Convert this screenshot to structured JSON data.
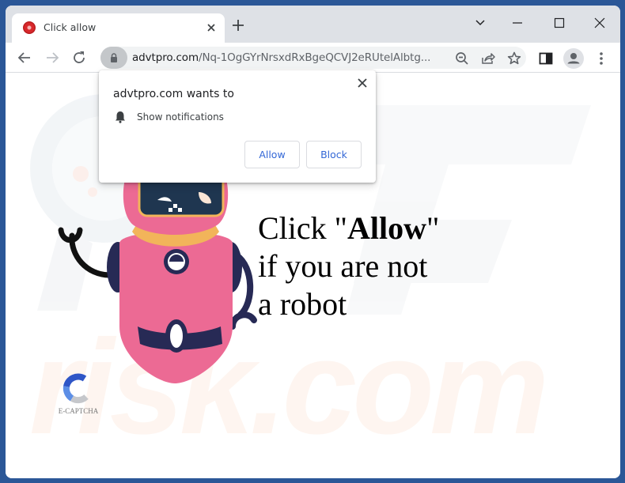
{
  "browser": {
    "tab": {
      "title": "Click allow",
      "favicon": "red-circle-favicon"
    },
    "new_tab_icon": "plus-icon",
    "window_controls": [
      "chevron-down-icon",
      "minimize-icon",
      "maximize-icon",
      "close-icon"
    ],
    "omnibox": {
      "host": "advtpro.com",
      "path": "/Nq-1OgGYrNrsxdRxBgeQCVJ2eRUtelAlbtg..."
    },
    "toolbar_icons": [
      "back-icon",
      "forward-icon",
      "reload-icon",
      "lock-icon",
      "zoom-out-icon",
      "share-icon",
      "bookmark-star-icon",
      "side-panel-icon",
      "profile-avatar-icon",
      "more-menu-icon"
    ]
  },
  "permission_popup": {
    "title": "advtpro.com wants to",
    "permission": "Show notifications",
    "allow_label": "Allow",
    "block_label": "Block"
  },
  "page": {
    "headline_prefix": "Click \"",
    "headline_bold": "Allow",
    "headline_suffix": "\"",
    "headline_line2": "if you are not",
    "headline_line3": "a robot",
    "captcha_label": "E-CAPTCHA"
  },
  "colors": {
    "window_frame": "#2b5797",
    "tabstrip": "#dee1e6",
    "button_text": "#3367d6",
    "robot_body": "#ec6a94",
    "robot_dark": "#272a55",
    "robot_collar": "#f2b45a"
  }
}
